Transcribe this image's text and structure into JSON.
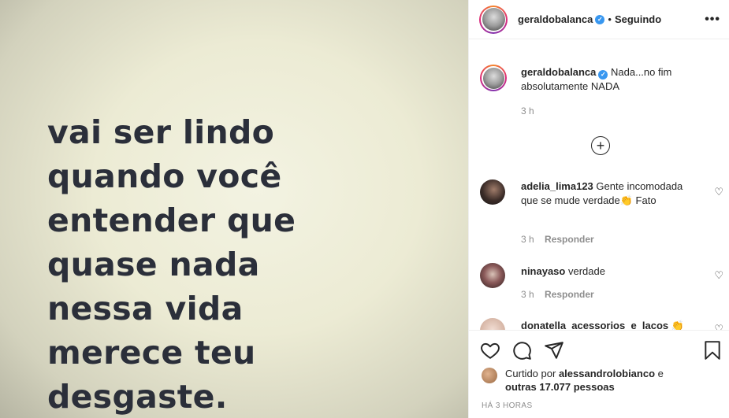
{
  "post": {
    "image_text_lines": [
      "vai ser lindo",
      "quando você",
      "entender que",
      "quase nada",
      "nessa vida",
      "merece teu",
      "desgaste."
    ]
  },
  "header": {
    "username": "geraldobalanca",
    "verified_mark": "✓",
    "separator": "•",
    "follow_status": "Seguindo",
    "more_label": "•••"
  },
  "caption": {
    "username": "geraldobalanca",
    "verified_mark": "✓",
    "text": "Nada...no fim absolutamente NADA",
    "time": "3 h"
  },
  "load_more_label": "+",
  "comments": [
    {
      "username": "adelia_lima123",
      "text": "Gente incomodada que se mude verdade👏 Fato",
      "time": "3 h",
      "reply_label": "Responder"
    },
    {
      "username": "ninayaso",
      "text": "verdade",
      "time": "3 h",
      "reply_label": "Responder"
    },
    {
      "username": "donatella_acessorios_e_lacos",
      "text": "👏",
      "time": "",
      "reply_label": ""
    }
  ],
  "actions": {
    "like_icon": "heart-icon",
    "comment_icon": "comment-icon",
    "share_icon": "share-icon",
    "save_icon": "bookmark-icon"
  },
  "likes": {
    "prefix": "Curtido por",
    "user": "alessandrolobianco",
    "middle": "e",
    "others": "outras 17.077 pessoas"
  },
  "footer_time": "HÁ 3 HORAS",
  "colors": {
    "brand_gradient": [
      "#f58529",
      "#dd2a7b",
      "#8134af"
    ],
    "verified_blue": "#3897f0",
    "muted_text": "#8e8e8e",
    "image_text": "#2b2f3a"
  }
}
